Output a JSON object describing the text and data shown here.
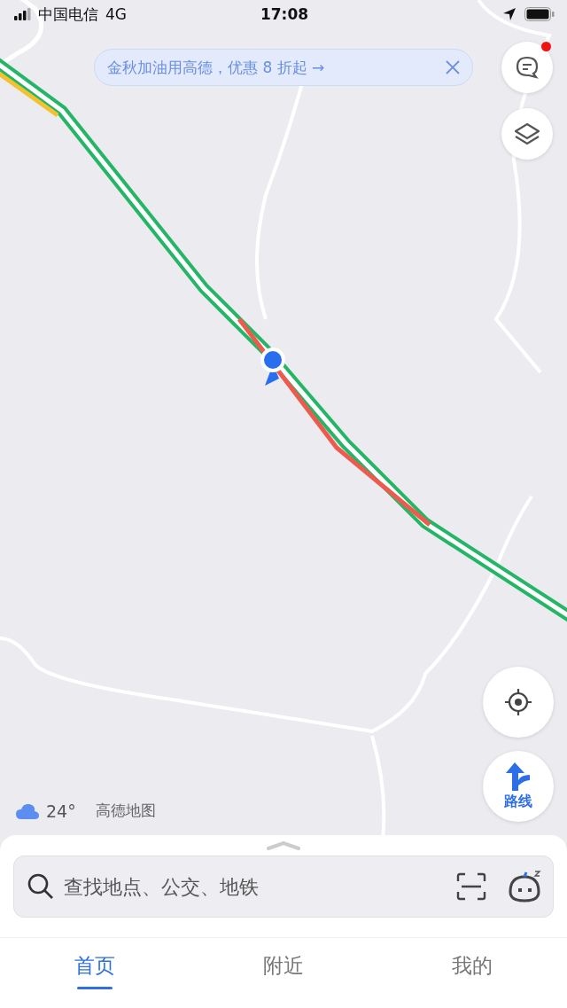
{
  "status_bar": {
    "carrier": "中国电信",
    "network": "4G",
    "time": "17:08"
  },
  "banner": {
    "text": "金秋加油用高德，优惠 8 折起 →"
  },
  "side_buttons": [
    {
      "kind": "messages",
      "unread": true
    },
    {
      "kind": "layers",
      "unread": false
    }
  ],
  "locate_button": {
    "kind": "locate"
  },
  "route_button": {
    "label": "路线"
  },
  "weather": {
    "temperature": "24°"
  },
  "brand": "高德地图",
  "search": {
    "placeholder": "查找地点、公交、地铁"
  },
  "tabs": [
    {
      "label": "首页",
      "selected": true
    },
    {
      "label": "附近",
      "selected": false
    },
    {
      "label": "我的",
      "selected": false
    }
  ]
}
